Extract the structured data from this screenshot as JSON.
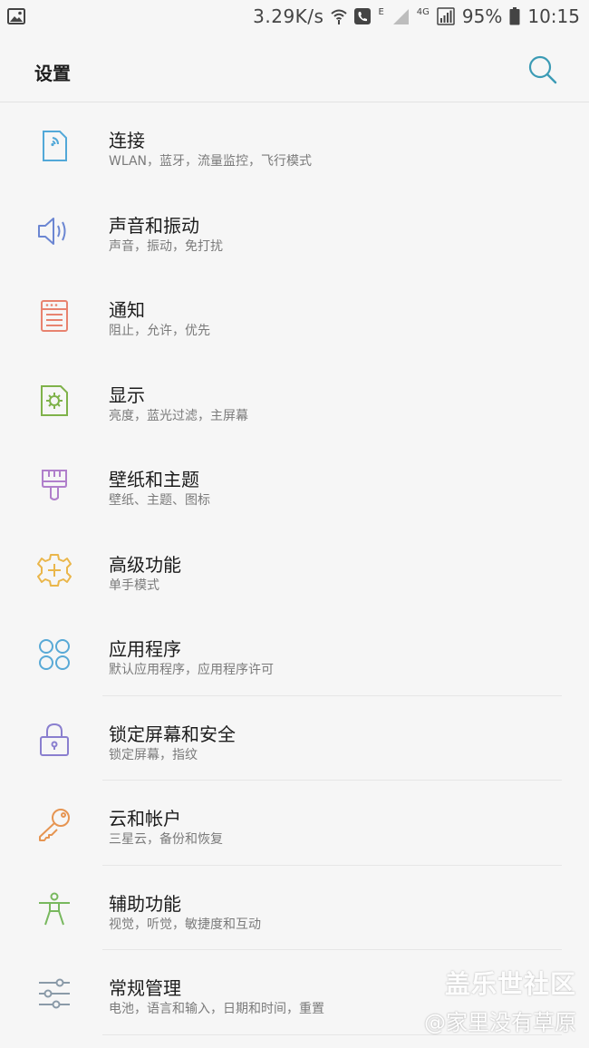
{
  "status_bar": {
    "gallery_icon": "image-icon",
    "speed": "3.29K/s",
    "wifi_icon": "wifi-icon",
    "call_icon": "phone-icon",
    "network_e": "E",
    "network_4g": "4G",
    "signal_icon": "signal-icon",
    "battery": "95%",
    "battery_icon": "battery-icon",
    "time": "10:15"
  },
  "header": {
    "title": "设置",
    "search_icon": "search-icon",
    "accent": "#3b9bb5"
  },
  "items": [
    {
      "label": "连接",
      "sub": "WLAN，蓝牙，流量监控，飞行模式",
      "icon": "connection-icon",
      "color": "#52a8d8"
    },
    {
      "label": "声音和振动",
      "sub": "声音，振动，免打扰",
      "icon": "volume-icon",
      "color": "#6b86d2"
    },
    {
      "label": "通知",
      "sub": "阻止，允许，优先",
      "icon": "notification-icon",
      "color": "#e8836f"
    },
    {
      "label": "显示",
      "sub": "亮度，蓝光过滤，主屏幕",
      "icon": "display-icon",
      "color": "#7fb24a"
    },
    {
      "label": "壁纸和主题",
      "sub": "壁纸、主题、图标",
      "icon": "paintbrush-icon",
      "color": "#b07fcb"
    },
    {
      "label": "高级功能",
      "sub": "单手模式",
      "icon": "gear-plus-icon",
      "color": "#eab64a"
    },
    {
      "label": "应用程序",
      "sub": "默认应用程序，应用程序许可",
      "icon": "apps-icon",
      "color": "#58a9d6"
    },
    {
      "label": "锁定屏幕和安全",
      "sub": "锁定屏幕，指纹",
      "icon": "lock-icon",
      "color": "#8a7fcf"
    },
    {
      "label": "云和帐户",
      "sub": "三星云，备份和恢复",
      "icon": "key-icon",
      "color": "#e69552"
    },
    {
      "label": "辅助功能",
      "sub": "视觉，听觉，敏捷度和互动",
      "icon": "accessibility-icon",
      "color": "#78b85e"
    },
    {
      "label": "常规管理",
      "sub": "电池，语言和输入，日期和时间，重置",
      "icon": "sliders-icon",
      "color": "#8a9aa8"
    }
  ],
  "watermark": {
    "line1": "盖乐世社区",
    "line2": "@家里没有草原"
  }
}
